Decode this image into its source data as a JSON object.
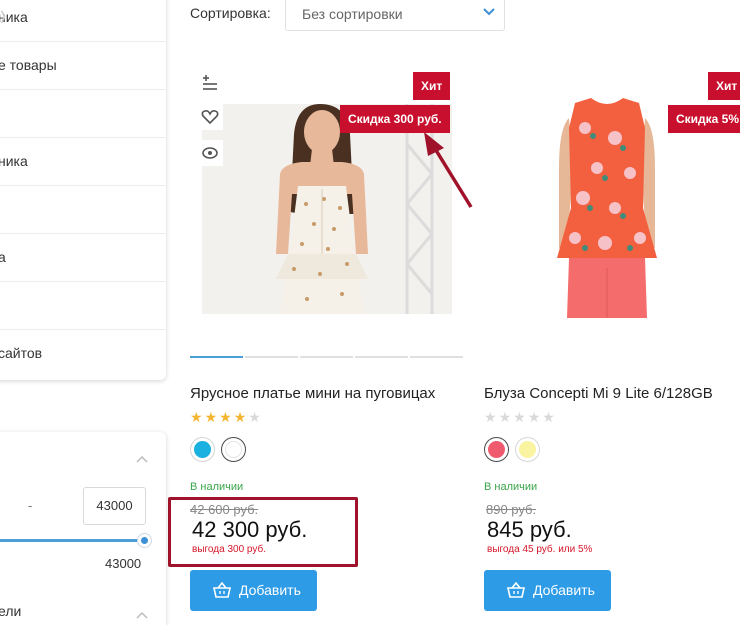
{
  "sidebar": {
    "items": [
      {
        "label": "ника",
        "chevron": true
      },
      {
        "label": "е товары",
        "chevron": false
      },
      {
        "label": "",
        "chevron": false
      },
      {
        "label": "ника",
        "chevron": false
      },
      {
        "label": "",
        "chevron": false
      },
      {
        "label": "а",
        "chevron": false
      },
      {
        "label": "",
        "chevron": false
      },
      {
        "label": "сайтов",
        "chevron": false
      }
    ]
  },
  "filter": {
    "dash": "-",
    "input_value": "43000",
    "max_label": "43000",
    "slider_fraction": 1.0,
    "section2_label": "ели"
  },
  "sort": {
    "label": "Сортировка:",
    "value": "Без сортировки"
  },
  "products": [
    {
      "badge_hit": "Хит",
      "badge_discount": "Скидка 300 руб.",
      "title": "Ярусное платье мини на пуговицах",
      "rating": 4,
      "rating_max": 5,
      "swatches": [
        "#1ab0e0",
        "#ffffff"
      ],
      "stock": "В наличии",
      "old_price": "42 600 руб.",
      "price": "42 300 руб.",
      "save": "выгода 300 руб.",
      "add_label": "Добавить"
    },
    {
      "badge_hit": "Хит",
      "badge_discount": "Скидка 5%",
      "title": "Блуза Concepti Mi 9 Lite 6/128GB",
      "rating": 0,
      "rating_max": 5,
      "swatches": [
        "#f05a6e",
        "#faf3a0"
      ],
      "stock": "В наличии",
      "old_price": "890 руб.",
      "price": "845 руб.",
      "save": "выгода 45 руб. или 5%",
      "add_label": "Добавить"
    }
  ],
  "colors": {
    "accent": "#2d9be6",
    "badge": "#c8102e",
    "annotation": "#a0122a",
    "stock": "#3aa54a",
    "save": "#d6162a"
  }
}
